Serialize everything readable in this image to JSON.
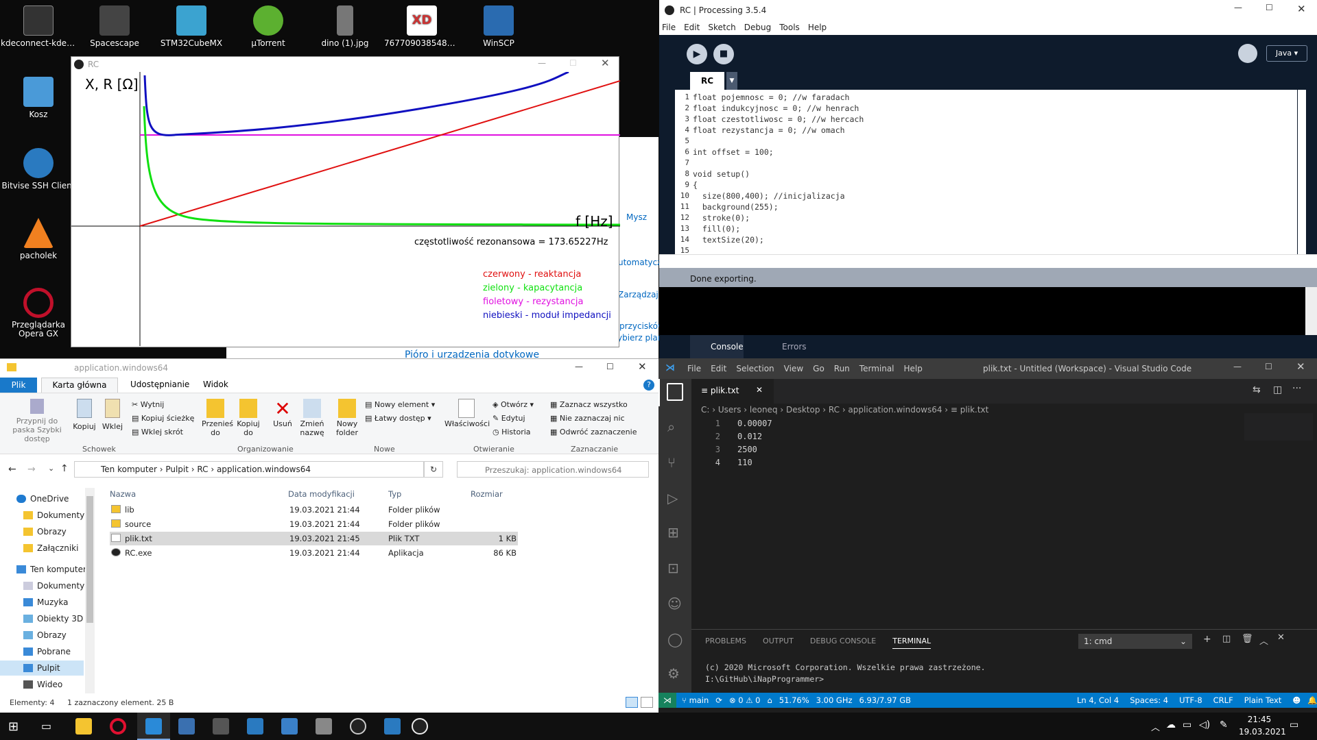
{
  "desktop": {
    "icons": [
      {
        "label": "kdeconnect-kde-1...",
        "color": "#333"
      },
      {
        "label": "Spacescape",
        "color": "#444"
      },
      {
        "label": "STM32CubeMX",
        "color": "#3ba3d0"
      },
      {
        "label": "µTorrent",
        "color": "#5cb030"
      },
      {
        "label": "dino (1).jpg",
        "color": "#777"
      },
      {
        "label": "7677090385482219...",
        "color": "#c33"
      },
      {
        "label": "WinSCP",
        "color": "#2a6bb0"
      },
      {
        "label": "Kosz",
        "color": "#4a9ad8"
      },
      {
        "label": "Bitvise SSH Client",
        "color": "#2a7ac0"
      },
      {
        "label": "pacholek",
        "color": "#f08020"
      },
      {
        "label": "Przeglądarka Opera GX",
        "color": "#c0102a"
      }
    ]
  },
  "rc_window": {
    "title": "RC",
    "ylabel": "X, R [Ω]",
    "xlabel": "f [Hz]",
    "resonance": "częstotliwość rezonansowa = 173.65227Hz",
    "legend": [
      {
        "text": "czerwony - reaktancja",
        "color": "#e01010"
      },
      {
        "text": "zielony - kapacytancja",
        "color": "#10e010"
      },
      {
        "text": "fioletowy - rezystancja",
        "color": "#e010e0"
      },
      {
        "text": "niebieski - moduł impedancji",
        "color": "#1010c0"
      }
    ],
    "behind_text": [
      "Mysz",
      "utomatyczni",
      "Zarządzaj u",
      "przycisków",
      "ybierz plan",
      "Pióro i urządzenia dotykowe"
    ]
  },
  "processing": {
    "title": "RC | Processing 3.5.4",
    "menu": [
      "File",
      "Edit",
      "Sketch",
      "Debug",
      "Tools",
      "Help"
    ],
    "mode": "Java ▾",
    "tab": "RC",
    "lines": [
      {
        "n": "1",
        "code": "float pojemnosc = 0; //w faradach"
      },
      {
        "n": "2",
        "code": "float indukcyjnosc = 0; //w henrach"
      },
      {
        "n": "3",
        "code": "float czestotliwosc = 0; //w hercach"
      },
      {
        "n": "4",
        "code": "float rezystancja = 0; //w omach"
      },
      {
        "n": "5",
        "code": ""
      },
      {
        "n": "6",
        "code": "int offset = 100;"
      },
      {
        "n": "7",
        "code": ""
      },
      {
        "n": "8",
        "code": "void setup()"
      },
      {
        "n": "9",
        "code": "{"
      },
      {
        "n": "10",
        "code": "  size(800,400); //inicjalizacja"
      },
      {
        "n": "11",
        "code": "  background(255);"
      },
      {
        "n": "12",
        "code": "  stroke(0);"
      },
      {
        "n": "13",
        "code": "  fill(0);"
      },
      {
        "n": "14",
        "code": "  textSize(20);"
      },
      {
        "n": "15",
        "code": ""
      }
    ],
    "status": "Done exporting.",
    "console_tab": "Console",
    "errors_tab": "Errors"
  },
  "explorer": {
    "title": "application.windows64",
    "tabs": [
      "Plik",
      "Karta główna",
      "Udostępnianie",
      "Widok"
    ],
    "ribbon": {
      "pin": "Przypnij do paska Szybki dostęp",
      "copy": "Kopiuj",
      "paste": "Wklej",
      "cut": "Wytnij",
      "copy_path": "Kopiuj ścieżkę",
      "paste_shortcut": "Wklej skrót",
      "group_clipboard": "Schowek",
      "move_to": "Przenieś do",
      "copy_to": "Kopiuj do",
      "delete": "Usuń",
      "rename": "Zmień nazwę",
      "group_organize": "Organizowanie",
      "new_folder": "Nowy folder",
      "new_item": "Nowy element",
      "easy_access": "Łatwy dostęp",
      "group_new": "Nowe",
      "properties": "Właściwości",
      "open": "Otwórz",
      "edit": "Edytuj",
      "history": "Historia",
      "group_open": "Otwieranie",
      "select_all": "Zaznacz wszystko",
      "select_none": "Nie zaznaczaj nic",
      "invert": "Odwróć zaznaczenie",
      "group_select": "Zaznaczanie"
    },
    "breadcrumb": [
      "Ten komputer",
      "Pulpit",
      "RC",
      "application.windows64"
    ],
    "search_placeholder": "Przeszukaj: application.windows64",
    "columns": [
      "Nazwa",
      "Data modyfikacji",
      "Typ",
      "Rozmiar"
    ],
    "files": [
      {
        "name": "lib",
        "date": "19.03.2021 21:44",
        "type": "Folder plików",
        "size": ""
      },
      {
        "name": "source",
        "date": "19.03.2021 21:44",
        "type": "Folder plików",
        "size": ""
      },
      {
        "name": "plik.txt",
        "date": "19.03.2021 21:45",
        "type": "Plik TXT",
        "size": "1 KB"
      },
      {
        "name": "RC.exe",
        "date": "19.03.2021 21:44",
        "type": "Aplikacja",
        "size": "86 KB"
      }
    ],
    "nav": [
      "OneDrive",
      "Dokumenty",
      "Obrazy",
      "Załączniki",
      "Ten komputer",
      "Dokumenty",
      "Muzyka",
      "Obiekty 3D",
      "Obrazy",
      "Pobrane",
      "Pulpit",
      "Wideo"
    ],
    "status_count": "Elementy: 4",
    "status_sel": "1 zaznaczony element. 25 B"
  },
  "vscode": {
    "menu": [
      "File",
      "Edit",
      "Selection",
      "View",
      "Go",
      "Run",
      "Terminal",
      "Help"
    ],
    "title": "plik.txt - Untitled (Workspace) - Visual Studio Code",
    "tab": "plik.txt",
    "breadcrumb": "C: › Users › leoneq › Desktop › RC › application.windows64 › ≡ plik.txt",
    "lines": [
      {
        "n": "1",
        "code": "0.00007"
      },
      {
        "n": "2",
        "code": "0.012"
      },
      {
        "n": "3",
        "code": "2500"
      },
      {
        "n": "4",
        "code": "110"
      }
    ],
    "panel_tabs": [
      "PROBLEMS",
      "OUTPUT",
      "DEBUG CONSOLE",
      "TERMINAL"
    ],
    "terminal_select": "1: cmd",
    "terminal_lines": [
      "(c) 2020 Microsoft Corporation. Wszelkie prawa zastrzeżone.",
      "",
      "I:\\GitHub\\iNapProgrammer>"
    ],
    "status_left": [
      "main",
      "⊗ 0 ⚠ 0",
      "51.76%",
      "3.00 GHz",
      "6.93/7.97 GB"
    ],
    "status_right": [
      "Ln 4, Col 4",
      "Spaces: 4",
      "UTF-8",
      "CRLF",
      "Plain Text"
    ]
  },
  "taskbar": {
    "time": "21:45",
    "date": "19.03.2021"
  }
}
